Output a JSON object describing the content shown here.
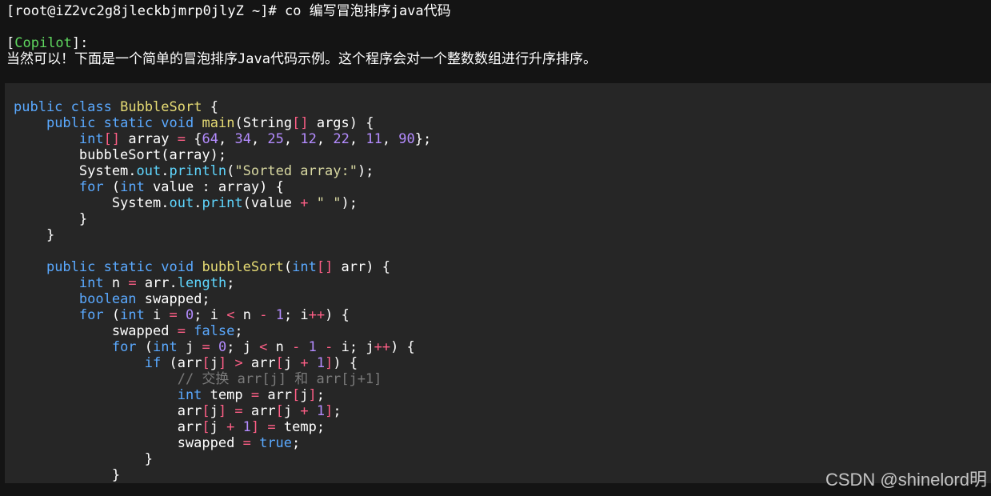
{
  "terminal": {
    "prompt": "[root@iZ2vc2g8jleckbjmrp0jlyZ ~]# ",
    "command": "co 编写冒泡排序java代码",
    "copilot_bracket_open": "[",
    "copilot_label": "Copilot",
    "copilot_bracket_close": "]:",
    "copilot_message": "当然可以！下面是一个简单的冒泡排序Java代码示例。这个程序会对一个整数数组进行升序排序。"
  },
  "code_lines": [
    [
      [
        "kw",
        "public"
      ],
      [
        "pl",
        " "
      ],
      [
        "kw",
        "class"
      ],
      [
        "pl",
        " "
      ],
      [
        "cls",
        "BubbleSort"
      ],
      [
        "pl",
        " {"
      ]
    ],
    [
      [
        "pl",
        "    "
      ],
      [
        "kw",
        "public"
      ],
      [
        "pl",
        " "
      ],
      [
        "kw",
        "static"
      ],
      [
        "pl",
        " "
      ],
      [
        "kw",
        "void"
      ],
      [
        "pl",
        " "
      ],
      [
        "fn",
        "main"
      ],
      [
        "pl",
        "(String"
      ],
      [
        "op",
        "[]"
      ],
      [
        "pl",
        " args) {"
      ]
    ],
    [
      [
        "pl",
        "        "
      ],
      [
        "kw",
        "int"
      ],
      [
        "op",
        "[]"
      ],
      [
        "pl",
        " array "
      ],
      [
        "op",
        "="
      ],
      [
        "pl",
        " {"
      ],
      [
        "num",
        "64"
      ],
      [
        "pl",
        ", "
      ],
      [
        "num",
        "34"
      ],
      [
        "pl",
        ", "
      ],
      [
        "num",
        "25"
      ],
      [
        "pl",
        ", "
      ],
      [
        "num",
        "12"
      ],
      [
        "pl",
        ", "
      ],
      [
        "num",
        "22"
      ],
      [
        "pl",
        ", "
      ],
      [
        "num",
        "11"
      ],
      [
        "pl",
        ", "
      ],
      [
        "num",
        "90"
      ],
      [
        "pl",
        "};"
      ]
    ],
    [
      [
        "pl",
        "        bubbleSort(array);"
      ]
    ],
    [
      [
        "pl",
        "        System."
      ],
      [
        "prop",
        "out"
      ],
      [
        "pl",
        "."
      ],
      [
        "prop",
        "println"
      ],
      [
        "pl",
        "("
      ],
      [
        "str",
        "\"Sorted array:\""
      ],
      [
        "pl",
        ");"
      ]
    ],
    [
      [
        "pl",
        "        "
      ],
      [
        "kw",
        "for"
      ],
      [
        "pl",
        " ("
      ],
      [
        "kw",
        "int"
      ],
      [
        "pl",
        " value : array) {"
      ]
    ],
    [
      [
        "pl",
        "            System."
      ],
      [
        "prop",
        "out"
      ],
      [
        "pl",
        "."
      ],
      [
        "prop",
        "print"
      ],
      [
        "pl",
        "(value "
      ],
      [
        "op",
        "+"
      ],
      [
        "pl",
        " "
      ],
      [
        "str",
        "\" \""
      ],
      [
        "pl",
        ");"
      ]
    ],
    [
      [
        "pl",
        "        }"
      ]
    ],
    [
      [
        "pl",
        "    }"
      ]
    ],
    [
      [
        "pl",
        ""
      ]
    ],
    [
      [
        "pl",
        "    "
      ],
      [
        "kw",
        "public"
      ],
      [
        "pl",
        " "
      ],
      [
        "kw",
        "static"
      ],
      [
        "pl",
        " "
      ],
      [
        "kw",
        "void"
      ],
      [
        "pl",
        " "
      ],
      [
        "fn",
        "bubbleSort"
      ],
      [
        "pl",
        "("
      ],
      [
        "kw",
        "int"
      ],
      [
        "op",
        "[]"
      ],
      [
        "pl",
        " arr) {"
      ]
    ],
    [
      [
        "pl",
        "        "
      ],
      [
        "kw",
        "int"
      ],
      [
        "pl",
        " n "
      ],
      [
        "op",
        "="
      ],
      [
        "pl",
        " arr."
      ],
      [
        "prop",
        "length"
      ],
      [
        "pl",
        ";"
      ]
    ],
    [
      [
        "pl",
        "        "
      ],
      [
        "kw",
        "boolean"
      ],
      [
        "pl",
        " swapped;"
      ]
    ],
    [
      [
        "pl",
        "        "
      ],
      [
        "kw",
        "for"
      ],
      [
        "pl",
        " ("
      ],
      [
        "kw",
        "int"
      ],
      [
        "pl",
        " i "
      ],
      [
        "op",
        "="
      ],
      [
        "pl",
        " "
      ],
      [
        "num",
        "0"
      ],
      [
        "pl",
        "; i "
      ],
      [
        "op",
        "<"
      ],
      [
        "pl",
        " n "
      ],
      [
        "op",
        "-"
      ],
      [
        "pl",
        " "
      ],
      [
        "num",
        "1"
      ],
      [
        "pl",
        "; i"
      ],
      [
        "op",
        "++"
      ],
      [
        "pl",
        ") {"
      ]
    ],
    [
      [
        "pl",
        "            swapped "
      ],
      [
        "op",
        "="
      ],
      [
        "pl",
        " "
      ],
      [
        "kw",
        "false"
      ],
      [
        "pl",
        ";"
      ]
    ],
    [
      [
        "pl",
        "            "
      ],
      [
        "kw",
        "for"
      ],
      [
        "pl",
        " ("
      ],
      [
        "kw",
        "int"
      ],
      [
        "pl",
        " j "
      ],
      [
        "op",
        "="
      ],
      [
        "pl",
        " "
      ],
      [
        "num",
        "0"
      ],
      [
        "pl",
        "; j "
      ],
      [
        "op",
        "<"
      ],
      [
        "pl",
        " n "
      ],
      [
        "op",
        "-"
      ],
      [
        "pl",
        " "
      ],
      [
        "num",
        "1"
      ],
      [
        "pl",
        " "
      ],
      [
        "op",
        "-"
      ],
      [
        "pl",
        " i; j"
      ],
      [
        "op",
        "++"
      ],
      [
        "pl",
        ") {"
      ]
    ],
    [
      [
        "pl",
        "                "
      ],
      [
        "kw",
        "if"
      ],
      [
        "pl",
        " (arr"
      ],
      [
        "op",
        "["
      ],
      [
        "pl",
        "j"
      ],
      [
        "op",
        "]"
      ],
      [
        "pl",
        " "
      ],
      [
        "op",
        ">"
      ],
      [
        "pl",
        " arr"
      ],
      [
        "op",
        "["
      ],
      [
        "pl",
        "j "
      ],
      [
        "op",
        "+"
      ],
      [
        "pl",
        " "
      ],
      [
        "num",
        "1"
      ],
      [
        "op",
        "]"
      ],
      [
        "pl",
        ") {"
      ]
    ],
    [
      [
        "pl",
        "                    "
      ],
      [
        "com",
        "// 交换 arr[j] 和 arr[j+1]"
      ]
    ],
    [
      [
        "pl",
        "                    "
      ],
      [
        "kw",
        "int"
      ],
      [
        "pl",
        " temp "
      ],
      [
        "op",
        "="
      ],
      [
        "pl",
        " arr"
      ],
      [
        "op",
        "["
      ],
      [
        "pl",
        "j"
      ],
      [
        "op",
        "]"
      ],
      [
        "pl",
        ";"
      ]
    ],
    [
      [
        "pl",
        "                    arr"
      ],
      [
        "op",
        "["
      ],
      [
        "pl",
        "j"
      ],
      [
        "op",
        "]"
      ],
      [
        "pl",
        " "
      ],
      [
        "op",
        "="
      ],
      [
        "pl",
        " arr"
      ],
      [
        "op",
        "["
      ],
      [
        "pl",
        "j "
      ],
      [
        "op",
        "+"
      ],
      [
        "pl",
        " "
      ],
      [
        "num",
        "1"
      ],
      [
        "op",
        "]"
      ],
      [
        "pl",
        ";"
      ]
    ],
    [
      [
        "pl",
        "                    arr"
      ],
      [
        "op",
        "["
      ],
      [
        "pl",
        "j "
      ],
      [
        "op",
        "+"
      ],
      [
        "pl",
        " "
      ],
      [
        "num",
        "1"
      ],
      [
        "op",
        "]"
      ],
      [
        "pl",
        " "
      ],
      [
        "op",
        "="
      ],
      [
        "pl",
        " temp;"
      ]
    ],
    [
      [
        "pl",
        "                    swapped "
      ],
      [
        "op",
        "="
      ],
      [
        "pl",
        " "
      ],
      [
        "kw",
        "true"
      ],
      [
        "pl",
        ";"
      ]
    ],
    [
      [
        "pl",
        "                }"
      ]
    ],
    [
      [
        "pl",
        "            }"
      ]
    ]
  ],
  "watermark": "CSDN @shinelord明",
  "colors": {
    "background": "#141414",
    "code_background": "#262626",
    "keyword": "#5aa9ff",
    "function": "#e6db74",
    "number": "#b48cff",
    "operator": "#ff5f87",
    "property": "#5fd7ff",
    "string": "#d7d7a0",
    "comment": "#7a7a7a",
    "copilot": "#5fd75f"
  }
}
